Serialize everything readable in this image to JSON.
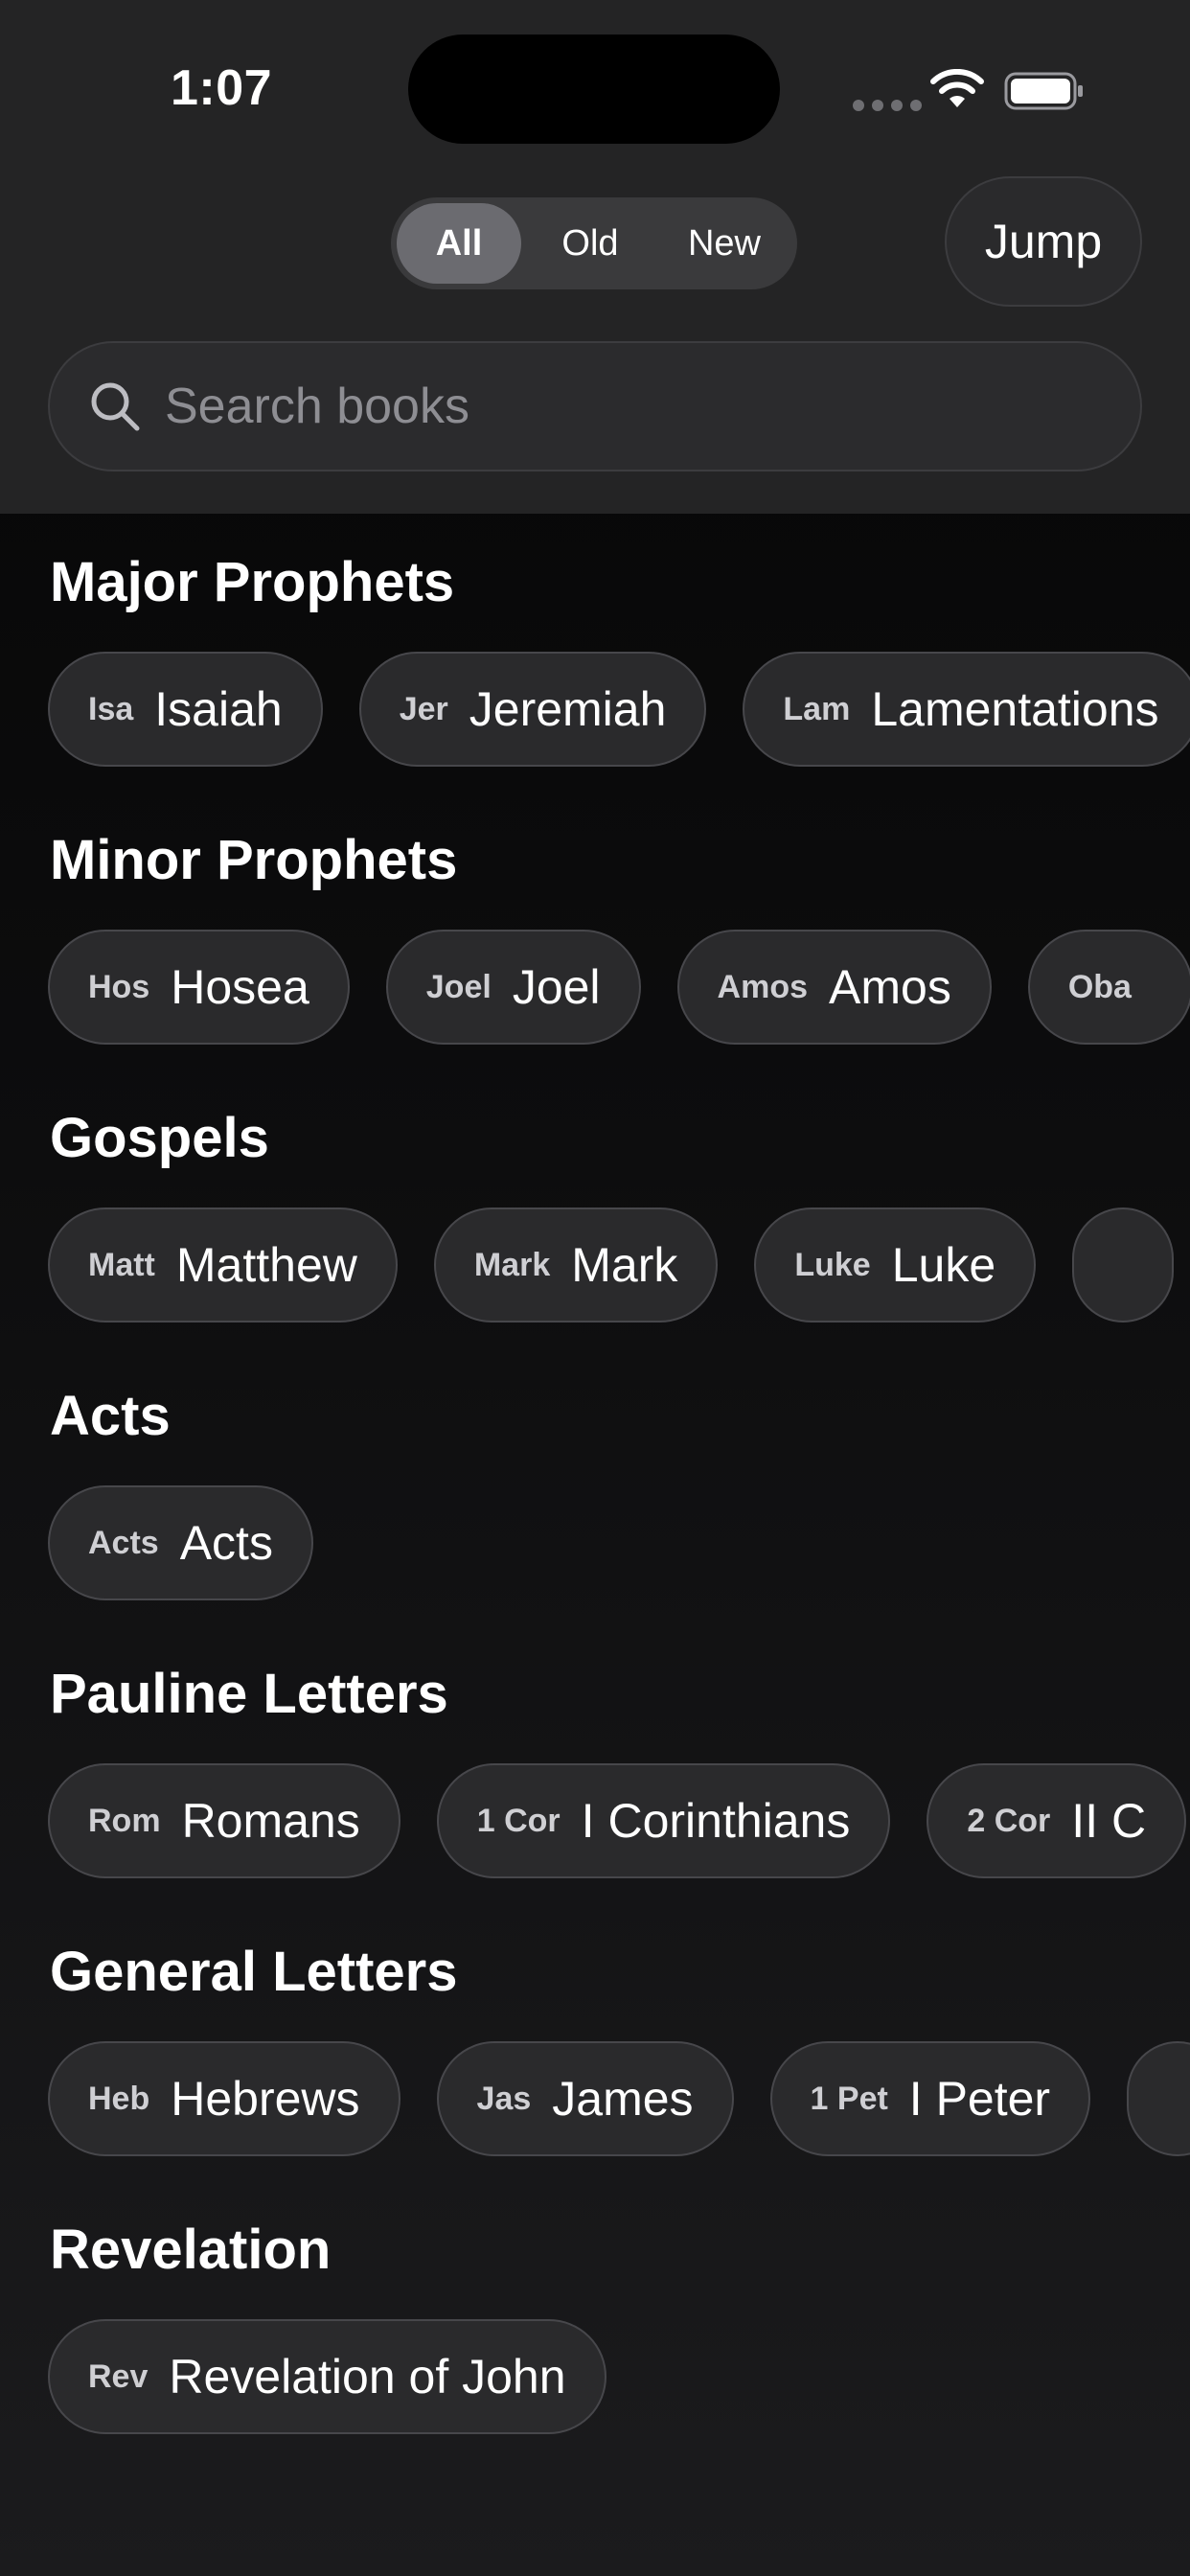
{
  "status_bar": {
    "time": "1:07"
  },
  "filter": {
    "options": [
      "All",
      "Old",
      "New"
    ],
    "selected": "All"
  },
  "jump_label": "Jump",
  "search": {
    "placeholder": "Search books",
    "value": ""
  },
  "sections": [
    {
      "title": "Major Prophets",
      "books": [
        {
          "abbr": "Isa",
          "name": "Isaiah"
        },
        {
          "abbr": "Jer",
          "name": "Jeremiah"
        },
        {
          "abbr": "Lam",
          "name": "Lamentations"
        }
      ]
    },
    {
      "title": "Minor Prophets",
      "books": [
        {
          "abbr": "Hos",
          "name": "Hosea"
        },
        {
          "abbr": "Joel",
          "name": "Joel"
        },
        {
          "abbr": "Amos",
          "name": "Amos"
        },
        {
          "abbr": "Oba",
          "name": ""
        }
      ]
    },
    {
      "title": "Gospels",
      "books": [
        {
          "abbr": "Matt",
          "name": "Matthew"
        },
        {
          "abbr": "Mark",
          "name": "Mark"
        },
        {
          "abbr": "Luke",
          "name": "Luke"
        },
        {
          "abbr": "",
          "name": ""
        }
      ]
    },
    {
      "title": "Acts",
      "books": [
        {
          "abbr": "Acts",
          "name": "Acts"
        }
      ]
    },
    {
      "title": "Pauline Letters",
      "books": [
        {
          "abbr": "Rom",
          "name": "Romans"
        },
        {
          "abbr": "1 Cor",
          "name": "I Corinthians"
        },
        {
          "abbr": "2 Cor",
          "name": "II C"
        }
      ]
    },
    {
      "title": "General Letters",
      "books": [
        {
          "abbr": "Heb",
          "name": "Hebrews"
        },
        {
          "abbr": "Jas",
          "name": "James"
        },
        {
          "abbr": "1 Pet",
          "name": "I Peter"
        },
        {
          "abbr": "",
          "name": ""
        }
      ]
    },
    {
      "title": "Revelation",
      "books": [
        {
          "abbr": "Rev",
          "name": "Revelation of John"
        }
      ]
    }
  ]
}
